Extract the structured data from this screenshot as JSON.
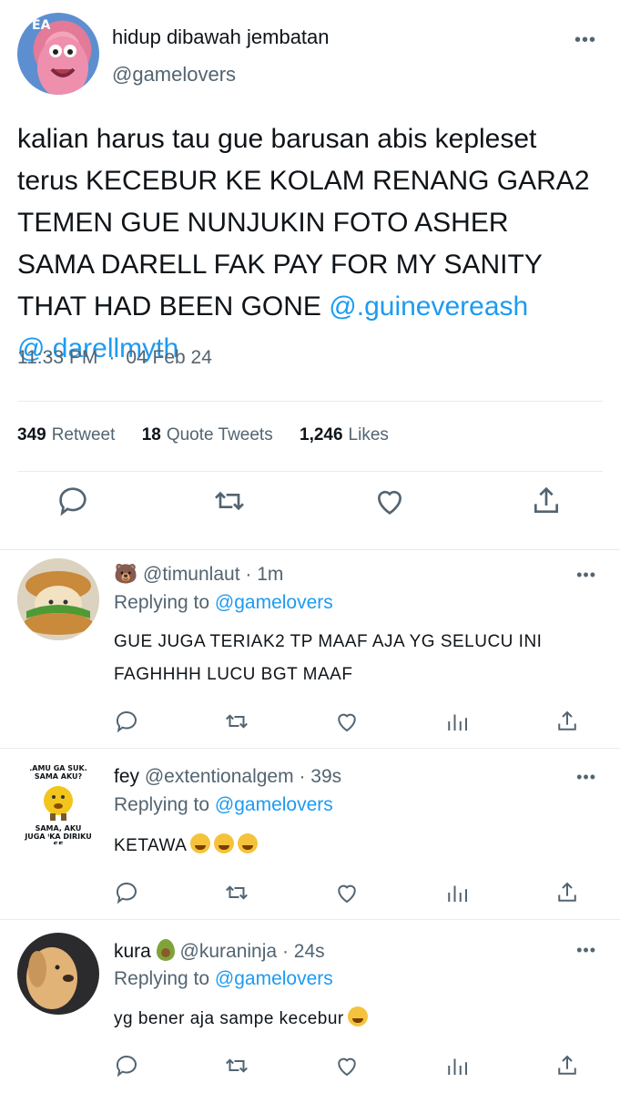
{
  "main_tweet": {
    "avatar_label": "EA",
    "display_name": "hidup dibawah jembatan",
    "handle": "@gamelovers",
    "more": "•••",
    "text_before": "kalian harus tau gue barusan abis kepleset terus KECEBUR KE KOLAM RENANG GARA2 TEMEN GUE NUNJUKIN FOTO ASHER SAMA DARELL FAK PAY FOR MY SANITY THAT HAD BEEN GONE",
    "mention1": "@.guinevereash",
    "mention2": "@.darellmyth",
    "time": "11:33 PM",
    "dot": "·",
    "date": "04 Feb 24",
    "stats": {
      "retweets_count": "349",
      "retweets_label": "Retweet",
      "quotes_count": "18",
      "quotes_label": "Quote Tweets",
      "likes_count": "1,246",
      "likes_label": "Likes"
    }
  },
  "replies": [
    {
      "emoji_name": "🐻",
      "handle": "@timunlaut",
      "time": "· 1m",
      "replying_label": "Replying to",
      "replying_to": "@gamelovers",
      "text": "GUE JUGA TERIAK2 TP MAAF AJA YG SELUCU INI FAGHHHH LUCU BGT MAAF",
      "more": "•••"
    },
    {
      "name": "fey",
      "handle": "@extentionalgem",
      "time": "· 39s",
      "replying_label": "Replying to",
      "replying_to": "@gamelovers",
      "text": "KETAWA",
      "avatar_text_top": ".AMU GA SUK. SAMA AKU?",
      "avatar_text_bottom": "SAMA, AKU JUGA ᴵKA DIRIKU SE",
      "more": "•••"
    },
    {
      "name": "kura",
      "handle": "@kuraninja",
      "time": "· 24s",
      "replying_label": "Replying to",
      "replying_to": "@gamelovers",
      "text": "yg bener aja sampe kecebur",
      "more": "•••"
    }
  ],
  "colors": {
    "accent": "#1d9bf0",
    "text": "#0f1419",
    "secondary": "#536471",
    "divider": "#e6ecf0"
  },
  "icons": [
    "reply-icon",
    "retweet-icon",
    "like-icon",
    "views-icon",
    "share-icon",
    "more-icon"
  ]
}
